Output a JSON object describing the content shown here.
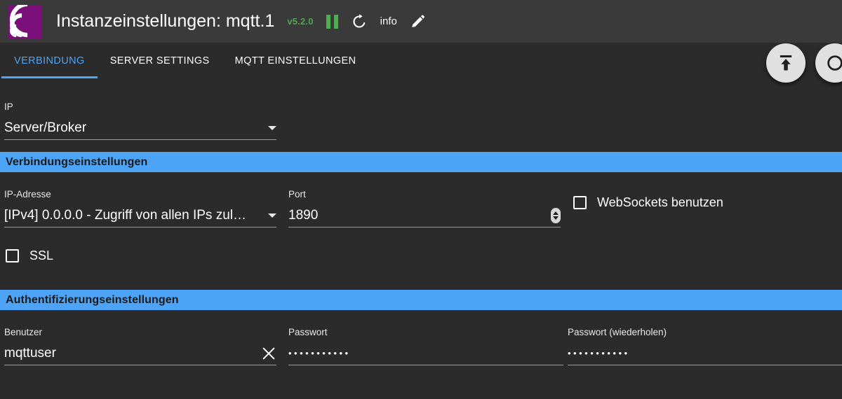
{
  "header": {
    "logo_icon": "mqtt-signal-logo",
    "title": "Instanzeinstellungen: mqtt.1",
    "version": "v5.2.0",
    "pause_icon": "pause-icon",
    "refresh_icon": "refresh-icon",
    "info_label": "info",
    "edit_icon": "pencil-icon",
    "bg_color": "#3a3a3a"
  },
  "tabs": [
    {
      "label": "VERBINDUNG",
      "active": true
    },
    {
      "label": "SERVER SETTINGS",
      "active": false
    },
    {
      "label": "MQTT EINSTELLUNGEN",
      "active": false
    }
  ],
  "fabs": [
    {
      "icon": "save-upload-icon"
    },
    {
      "icon": "secondary-fab-icon"
    }
  ],
  "form": {
    "ip_mode": {
      "label": "IP",
      "value": "Server/Broker"
    },
    "connection_section": {
      "title": "Verbindungseinstellungen"
    },
    "ip_address": {
      "label": "IP-Adresse",
      "value": "[IPv4] 0.0.0.0 - Zugriff von allen IPs zul…"
    },
    "port": {
      "label": "Port",
      "value": "1890"
    },
    "websockets": {
      "label": "WebSockets benutzen",
      "checked": false
    },
    "ssl": {
      "label": "SSL",
      "checked": false
    },
    "auth_section": {
      "title": "Authentifizierungseinstellungen"
    },
    "user": {
      "label": "Benutzer",
      "value": "mqttuser"
    },
    "password": {
      "label": "Passwort",
      "value": "•••••••••••"
    },
    "password_repeat": {
      "label": "Passwort (wiederholen)",
      "value": "•••••••••••"
    }
  },
  "colors": {
    "accent": "#4da3f5",
    "background": "#2b2b2b",
    "header": "#3a3a3a",
    "version_green": "#56a256",
    "logo_purple": "#7a0f7a"
  }
}
